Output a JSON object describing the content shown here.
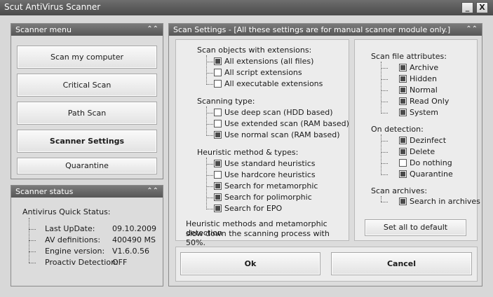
{
  "window": {
    "title": "Scut AntiVirus Scanner",
    "minimize_label": "_",
    "close_label": "X"
  },
  "scanner_menu": {
    "header": "Scanner menu",
    "collapse_icon": "chevron-up-double-icon",
    "buttons": [
      {
        "label": "Scan my computer"
      },
      {
        "label": "Critical Scan"
      },
      {
        "label": "Path Scan"
      },
      {
        "label": "Scanner Settings",
        "active": true
      },
      {
        "label": "Quarantine"
      }
    ]
  },
  "scanner_status": {
    "header": "Scanner status",
    "heading": "Antivirus Quick Status:",
    "rows": [
      {
        "label": "Last UpDate:",
        "value": "09.10.2009"
      },
      {
        "label": "AV definitions:",
        "value": "400490 MS"
      },
      {
        "label": "Engine version:",
        "value": "V1.6.0.56"
      },
      {
        "label": "Proactiv Detection:",
        "value": "OFF"
      }
    ]
  },
  "settings": {
    "header": "Scan Settings - [All these settings are for manual scanner module only.]",
    "extensions": {
      "title": "Scan objects with extensions:",
      "options": [
        {
          "label": "All extensions (all files)",
          "checked": true
        },
        {
          "label": "All script extensions",
          "checked": false
        },
        {
          "label": "All executable extensions",
          "checked": false
        }
      ]
    },
    "scanning_type": {
      "title": "Scanning type:",
      "options": [
        {
          "label": "Use deep scan (HDD based)",
          "checked": false
        },
        {
          "label": "Use extended scan (RAM based)",
          "checked": false
        },
        {
          "label": "Use normal scan (RAM based)",
          "checked": true
        }
      ]
    },
    "heuristic": {
      "title": "Heuristic method & types:",
      "options": [
        {
          "label": "Use standard heuristics",
          "checked": true
        },
        {
          "label": "Use hardcore heuristics",
          "checked": false
        },
        {
          "label": "Search for metamorphic",
          "checked": true
        },
        {
          "label": "Search for polimorphic",
          "checked": true
        },
        {
          "label": "Search for EPO",
          "checked": true
        }
      ]
    },
    "note_line1": "Heuristic methods and metamorphic detection",
    "note_line2": "slow down the scanning process with 50%.",
    "attributes": {
      "title": "Scan file attributes:",
      "options": [
        {
          "label": "Archive",
          "checked": true
        },
        {
          "label": "Hidden",
          "checked": true
        },
        {
          "label": "Normal",
          "checked": true
        },
        {
          "label": "Read Only",
          "checked": true
        },
        {
          "label": "System",
          "checked": true
        }
      ]
    },
    "detection": {
      "title": "On detection:",
      "options": [
        {
          "label": "Dezinfect",
          "checked": true
        },
        {
          "label": "Delete",
          "checked": true
        },
        {
          "label": "Do nothing",
          "checked": false
        },
        {
          "label": "Quarantine",
          "checked": true
        }
      ]
    },
    "archives": {
      "title": "Scan archives:",
      "options": [
        {
          "label": "Search in archives",
          "checked": true
        }
      ]
    },
    "default_button": "Set all to default",
    "ok_button": "Ok",
    "cancel_button": "Cancel"
  }
}
